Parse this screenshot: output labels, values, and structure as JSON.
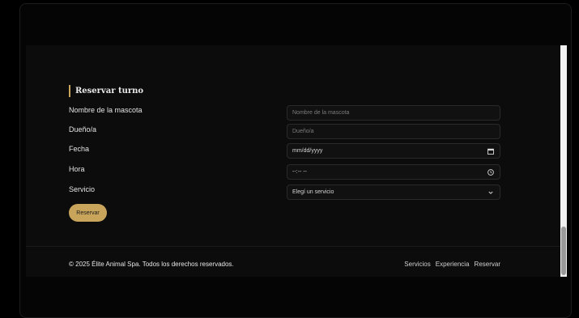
{
  "reservation": {
    "title": "Reservar turno",
    "labels": {
      "pet_name": "Nombre de la mascota",
      "owner": "Dueño/a",
      "date": "Fecha",
      "time": "Hora",
      "service": "Servicio"
    },
    "fields": {
      "pet_name_placeholder": "Nombre de la mascota",
      "owner_placeholder": "Dueño/a",
      "date_value": "mm/dd/yyyy",
      "time_value": "--:-- --",
      "service_selected": "Elegí un servicio"
    },
    "submit_label": "Reservar"
  },
  "footer": {
    "copyright": "© 2025 Élite Animal Spa. Todos los derechos reservados.",
    "links": [
      "Servicios",
      "Experiencia",
      "Reservar"
    ]
  },
  "colors": {
    "accent": "#c9a55c",
    "background": "#0c0c0c"
  },
  "icons": {
    "date": "calendar-icon",
    "time": "clock-icon",
    "service": "chevron-down-icon"
  }
}
